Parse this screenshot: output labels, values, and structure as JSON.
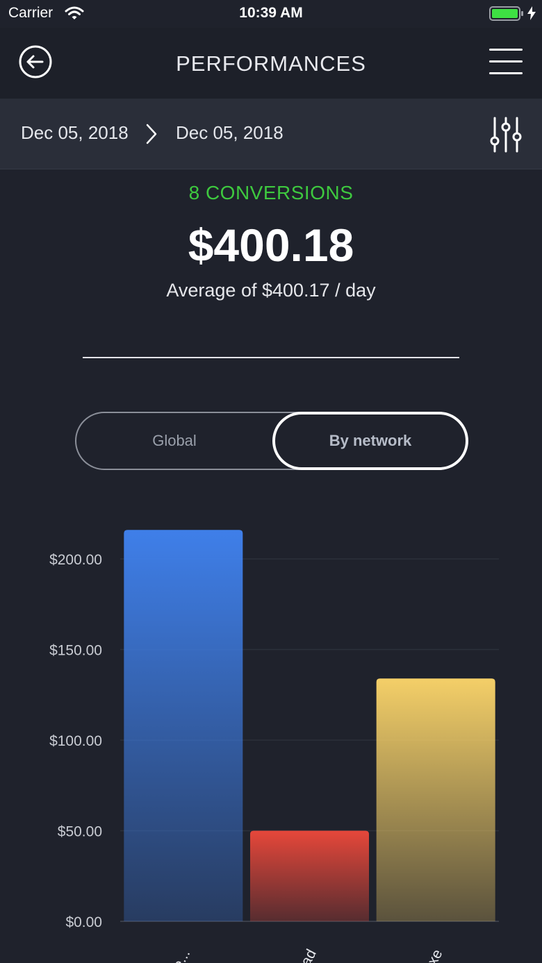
{
  "status_bar": {
    "carrier": "Carrier",
    "time": "10:39 AM",
    "battery_color": "#3ee043"
  },
  "nav": {
    "title": "PERFORMANCES",
    "back_icon": "back-arrow-icon",
    "menu_icon": "hamburger-menu-icon"
  },
  "date_range": {
    "from": "Dec 05, 2018",
    "to": "Dec 05, 2018",
    "filter_icon": "sliders-icon"
  },
  "summary": {
    "conversions": "8 CONVERSIONS",
    "total": "$400.18",
    "average": "Average of $400.17 / day",
    "accent_color": "#3ec93f"
  },
  "toggle": {
    "options": [
      "Global",
      "By network"
    ],
    "selected": "By network"
  },
  "chart_data": {
    "type": "bar",
    "categories": [
      "...te...",
      "lead",
      "...iaxe"
    ],
    "values": [
      216,
      50,
      134
    ],
    "colors": [
      "#3f7fe9",
      "#e6473a",
      "#f4cf68"
    ],
    "ylim": [
      0,
      200
    ],
    "yticks": [
      "$0.00",
      "$50.00",
      "$100.00",
      "$150.00",
      "$200.00"
    ],
    "grid": true
  }
}
